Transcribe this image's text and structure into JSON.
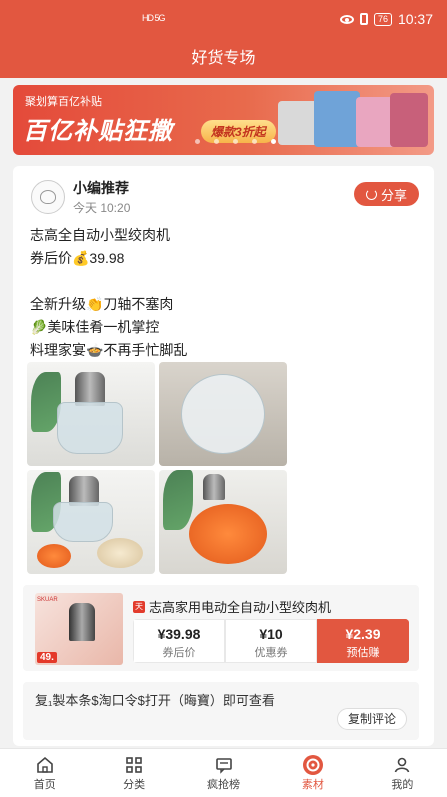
{
  "status_bar": {
    "time": "10:37",
    "battery": "76",
    "signal": "HD 5G"
  },
  "header": {
    "title": "好货专场"
  },
  "banner": {
    "subtitle": "聚划算百亿补贴",
    "headline": "百亿补贴狂撒",
    "badge": "爆款3折起"
  },
  "post": {
    "author": "小编推荐",
    "time": "今天 10:20",
    "share_label": "分享",
    "lines": [
      "志高全自动小型绞肉机",
      "券后价💰39.98",
      "",
      "全新升级👏刀轴不塞肉",
      "🥬美味佳肴一机掌控",
      "料理家宴🍲不再手忙脚乱"
    ]
  },
  "product": {
    "title": "志高家用电动全自动小型绞肉机",
    "thumb_label": "SKUAR",
    "thumb_price": "49.",
    "boxes": [
      {
        "value": "¥39.98",
        "label": "券后价"
      },
      {
        "value": "¥10",
        "label": "优惠券"
      },
      {
        "value": "¥2.39",
        "label": "预估赚"
      }
    ]
  },
  "copy": {
    "text": "复₁製本条$淘口令$打开（晦寶）即可查看",
    "button": "复制评论"
  },
  "tabs": [
    {
      "label": "首页",
      "icon": "home-icon"
    },
    {
      "label": "分类",
      "icon": "grid-icon"
    },
    {
      "label": "疯抢榜",
      "icon": "chat-icon"
    },
    {
      "label": "素材",
      "icon": "material-icon",
      "active": true
    },
    {
      "label": "我的",
      "icon": "user-icon"
    }
  ],
  "colors": {
    "accent": "#e25740"
  }
}
